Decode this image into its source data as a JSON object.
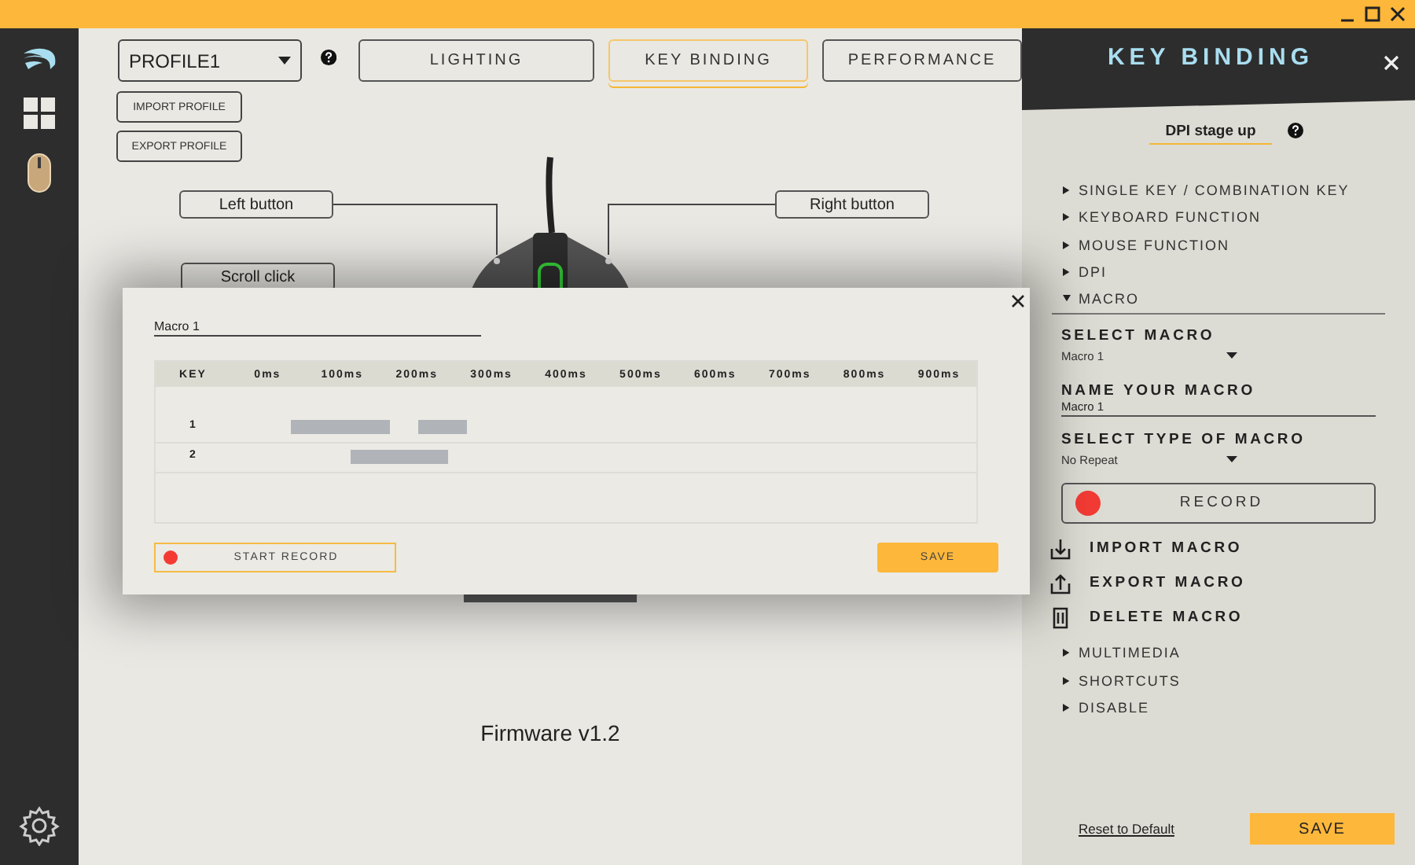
{
  "profile": {
    "value": "PROFILE1"
  },
  "profile_buttons": [
    "IMPORT PROFILE",
    "EXPORT PROFILE"
  ],
  "tabs": [
    {
      "label": "LIGHTING",
      "selected": false
    },
    {
      "label": "KEY BINDING",
      "selected": true
    },
    {
      "label": "PERFORMANCE",
      "selected": false
    }
  ],
  "mouse_callouts": [
    {
      "kind": "left",
      "label": "Left button"
    },
    {
      "kind": "right",
      "label": "Right button"
    },
    {
      "kind": "scroll",
      "label": "Scroll click"
    }
  ],
  "firmware": "Firmware v1.2",
  "macro_dialog": {
    "name": "Macro 1",
    "columns": [
      "KEY",
      "0ms",
      "100ms",
      "200ms",
      "300ms",
      "400ms",
      "500ms",
      "600ms",
      "700ms",
      "800ms",
      "900ms"
    ],
    "rows": [
      {
        "key": "1"
      },
      {
        "key": "2"
      }
    ],
    "record_button": "START RECORD",
    "save_button": "SAVE"
  },
  "key_binding_panel": {
    "title": "KEY BINDING",
    "selected_key": "DPI stage up",
    "categories": [
      {
        "label": "SINGLE KEY / COMBINATION KEY",
        "expanded": false
      },
      {
        "label": "KEYBOARD FUNCTION",
        "expanded": false
      },
      {
        "label": "MOUSE FUNCTION",
        "expanded": false
      },
      {
        "label": "DPI",
        "expanded": false
      },
      {
        "label": "MACRO",
        "expanded": true,
        "options": {
          "select_macro": {
            "label": "SELECT MACRO",
            "value": "Macro 1"
          },
          "name_macro": {
            "label": "NAME YOUR MACRO",
            "value": "Macro 1"
          },
          "macro_type": {
            "label": "SELECT TYPE OF MACRO",
            "value": "No Repeat"
          },
          "record_button": "RECORD",
          "actions": [
            {
              "kind": "import",
              "label": "IMPORT MACRO"
            },
            {
              "kind": "export",
              "label": "EXPORT MACRO"
            },
            {
              "kind": "delete",
              "label": "DELETE MACRO"
            }
          ]
        }
      },
      {
        "label": "MULTIMEDIA",
        "expanded": false
      },
      {
        "label": "SHORTCUTS",
        "expanded": false
      },
      {
        "label": "DISABLE",
        "expanded": false
      }
    ],
    "reset_link": "Reset to Default",
    "save_button": "SAVE"
  }
}
